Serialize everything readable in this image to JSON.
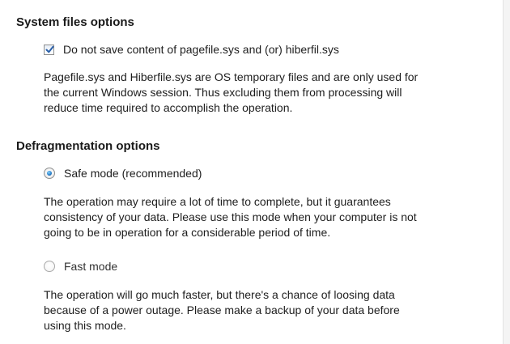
{
  "system_files": {
    "title": "System files options",
    "checkbox_label": "Do not save content of pagefile.sys and (or) hiberfil.sys",
    "checkbox_checked": true,
    "description_lines": [
      "Pagefile.sys and Hiberfile.sys are OS temporary files and are only used for",
      "the current Windows session. Thus excluding them from processing will",
      "reduce time required to accomplish the operation."
    ]
  },
  "defrag": {
    "title": "Defragmentation options",
    "safe_mode": {
      "label": "Safe mode (recommended)",
      "selected": true,
      "description_lines": [
        "The operation may require a lot of time to complete, but it guarantees",
        "consistency of your data. Please use this mode when your computer is not",
        "going to be in operation for a considerable period of time."
      ]
    },
    "fast_mode": {
      "label": "Fast mode",
      "selected": false,
      "description_lines": [
        "The operation will go much faster, but there's a chance of loosing data",
        "because of a power outage. Please make a backup of your data before",
        "using this mode."
      ]
    }
  },
  "colors": {
    "check_mark": "#2a5fa8",
    "radio_selected": "#2a7fc9"
  }
}
